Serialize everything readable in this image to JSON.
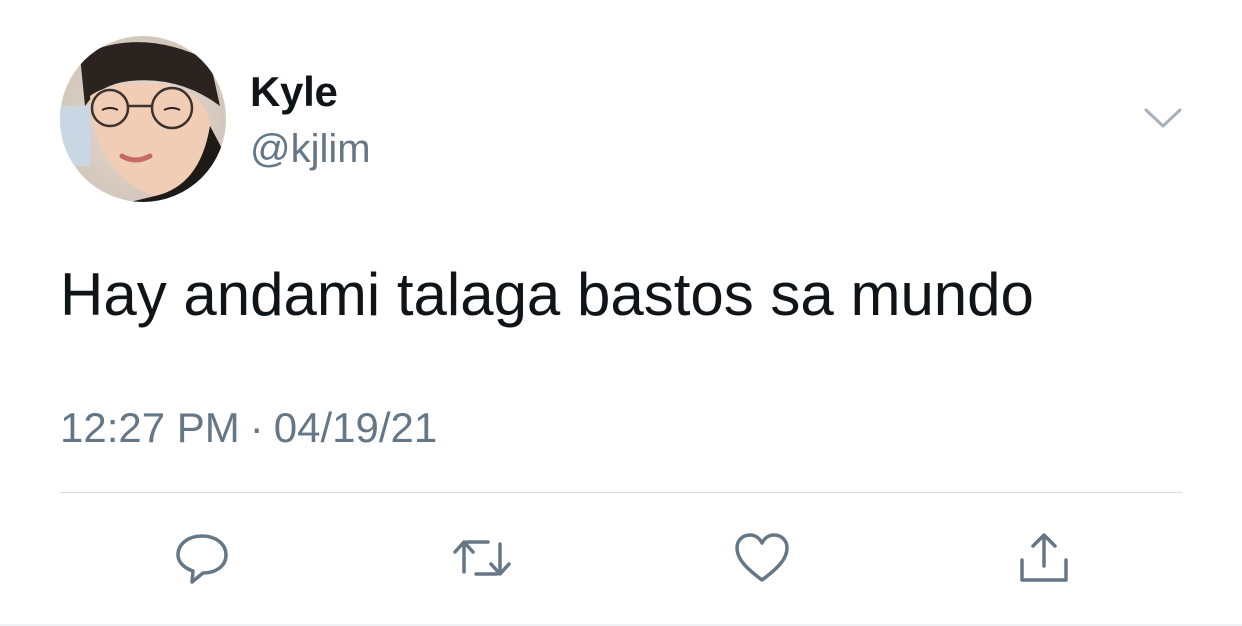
{
  "tweet": {
    "author": {
      "display_name": "Kyle",
      "handle": "@kjlim"
    },
    "text": "Hay andami talaga bastos sa mundo",
    "time": "12:27 PM",
    "separator": "·",
    "date": "04/19/21"
  },
  "icons": {
    "menu": "chevron-down-icon",
    "reply": "speech-bubble-icon",
    "retweet": "retweet-icon",
    "like": "heart-icon",
    "share": "share-icon"
  },
  "colors": {
    "text_primary": "#0f1419",
    "text_secondary": "#657786",
    "icon": "#657786",
    "divider": "#d8dfe4"
  }
}
